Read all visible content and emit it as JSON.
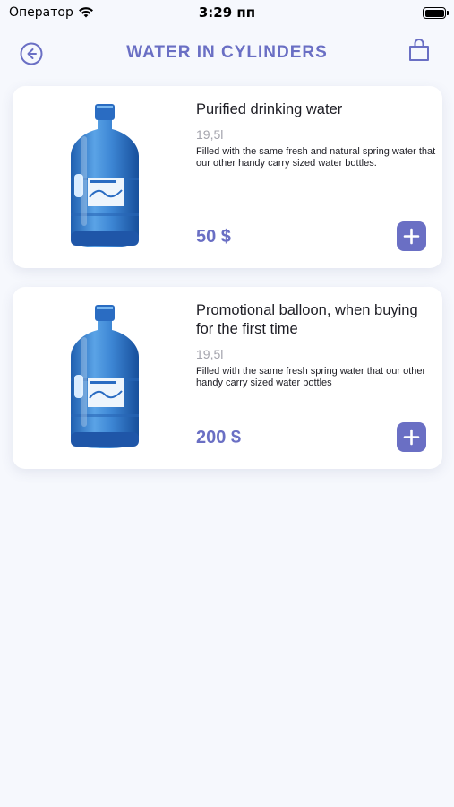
{
  "status_bar": {
    "carrier": "Оператор",
    "time": "3:29 пп"
  },
  "header": {
    "title": "WATER IN CYLINDERS",
    "back_icon": "arrow-left-circle-icon",
    "cart_icon": "shopping-bag-icon"
  },
  "products": [
    {
      "name": "Purified drinking water",
      "volume": "19,5l",
      "description": "Filled with the same fresh and natural spring water that our other handy carry sized water bottles.",
      "price": "50 $",
      "image_icon": "water-cylinder-image"
    },
    {
      "name": "Promotional balloon, when buying for the first time",
      "volume": "19,5l",
      "description": "Filled with the same fresh spring water that our other handy carry sized water bottles",
      "price": "200 $",
      "image_icon": "water-cylinder-image"
    }
  ],
  "colors": {
    "accent": "#6a6fc4",
    "background": "#f6f8fd",
    "card": "#ffffff",
    "muted_text": "#a4a4ad"
  }
}
